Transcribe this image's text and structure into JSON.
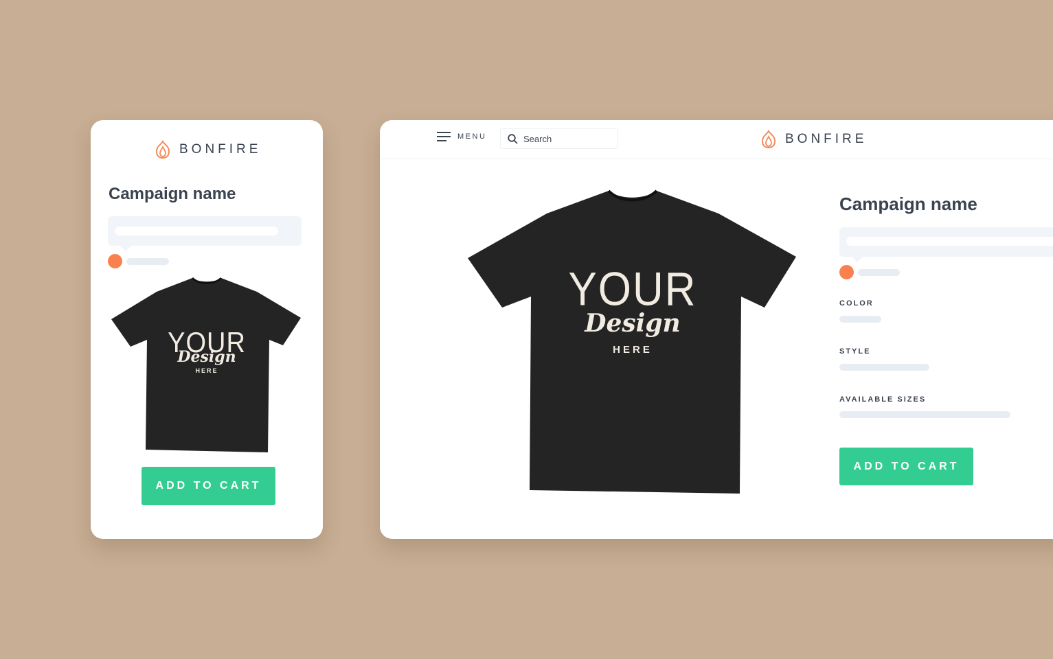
{
  "brand": {
    "name": "BONFIRE",
    "accent": "#f58a5a"
  },
  "colors": {
    "background": "#c7ae94",
    "cta": "#33cd92",
    "text": "#3a4350",
    "skeleton": "#e7edf3",
    "swatch": "#f9814f",
    "shirt": "#242424",
    "print": "#f1ebe2"
  },
  "mobile": {
    "campaign_title": "Campaign name",
    "add_to_cart": "ADD TO CART"
  },
  "desktop": {
    "menu_label": "MENU",
    "search_placeholder": "Search",
    "campaign_title": "Campaign name",
    "color_label": "COLOR",
    "style_label": "STYLE",
    "sizes_label": "AVAILABLE SIZES",
    "add_to_cart": "ADD TO CART"
  },
  "shirt_print": {
    "line1": "YOUR",
    "line2": "Design",
    "line3": "HERE"
  },
  "icons": [
    "bonfire-flame-logo-icon",
    "hamburger-menu-icon",
    "search-icon"
  ]
}
